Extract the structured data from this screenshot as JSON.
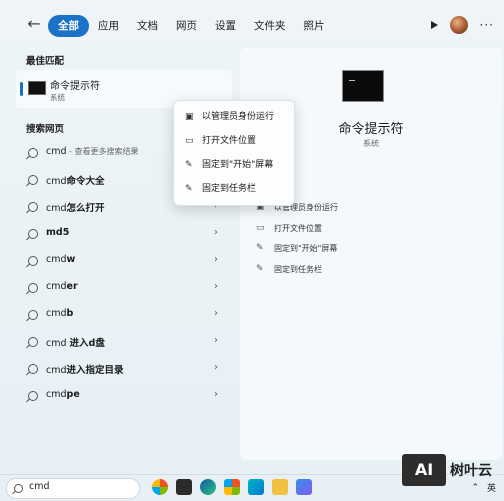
{
  "header": {
    "back_icon": "←",
    "tabs": [
      {
        "label": "全部",
        "active": true
      },
      {
        "label": "应用"
      },
      {
        "label": "文档"
      },
      {
        "label": "网页"
      },
      {
        "label": "设置"
      },
      {
        "label": "文件夹"
      },
      {
        "label": "照片"
      }
    ],
    "more_icon": "···"
  },
  "left": {
    "best_match_title": "最佳匹配",
    "best_match": {
      "name": "命令提示符",
      "sub": "系统"
    },
    "web_search_title": "搜索网页",
    "results": [
      {
        "pre": "cmd",
        "bold": "",
        "hint": " - 查看更多搜索结果"
      },
      {
        "pre": "cmd",
        "bold": "命令大全",
        "hint": ""
      },
      {
        "pre": "cmd",
        "bold": "怎么打开",
        "hint": ""
      },
      {
        "pre": "",
        "bold": "md5",
        "hint": ""
      },
      {
        "pre": "cmd",
        "bold": "w",
        "hint": ""
      },
      {
        "pre": "cmd",
        "bold": "er",
        "hint": ""
      },
      {
        "pre": "cmd",
        "bold": "b",
        "hint": ""
      },
      {
        "pre": "cmd ",
        "bold": "进入d盘",
        "hint": ""
      },
      {
        "pre": "cmd",
        "bold": "进入指定目录",
        "hint": ""
      },
      {
        "pre": "cmd",
        "bold": "pe",
        "hint": ""
      }
    ],
    "chevron": "›"
  },
  "right": {
    "title": "命令提示符",
    "sub": "系统",
    "actions": [
      {
        "icon": "▣",
        "label": "以管理员身份运行"
      },
      {
        "icon": "▭",
        "label": "打开文件位置"
      },
      {
        "icon": "✎",
        "label": "固定到\"开始\"屏幕"
      },
      {
        "icon": "✎",
        "label": "固定到任务栏"
      }
    ]
  },
  "context_menu": {
    "items": [
      {
        "icon": "▣",
        "label": "以管理员身份运行"
      },
      {
        "icon": "▭",
        "label": "打开文件位置"
      },
      {
        "icon": "✎",
        "label": "固定到\"开始\"屏幕"
      },
      {
        "icon": "✎",
        "label": "固定到任务栏"
      }
    ]
  },
  "taskbar": {
    "search_value": "cmd",
    "tray": {
      "chevron": "⌃",
      "lang": "英"
    }
  },
  "watermark": {
    "logo": "AI",
    "text": "树叶云"
  },
  "colors": {
    "accent": "#1a73c7"
  }
}
